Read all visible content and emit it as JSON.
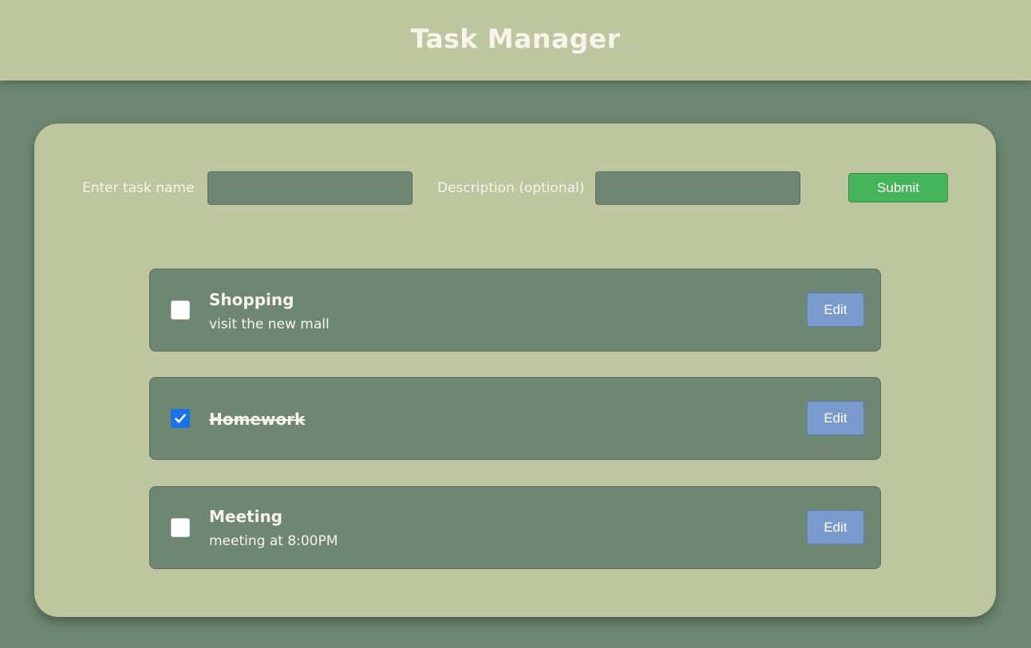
{
  "header": {
    "title": "Task Manager"
  },
  "form": {
    "task_name_label": "Enter task name",
    "task_name_value": "",
    "description_label": "Description (optional)",
    "description_value": "",
    "submit_label": "Submit"
  },
  "tasks": [
    {
      "title": "Shopping",
      "description": "visit the new mall",
      "completed": false,
      "edit_label": "Edit"
    },
    {
      "title": "Homework",
      "description": "",
      "completed": true,
      "edit_label": "Edit"
    },
    {
      "title": "Meeting",
      "description": "meeting at 8:00PM",
      "completed": false,
      "edit_label": "Edit"
    }
  ],
  "colors": {
    "page_background": "#6e8772",
    "panel_background": "#bec69f",
    "submit_button": "#45b35a",
    "edit_button": "#7a99cc",
    "checkbox_checked": "#1a73e8",
    "text": "#f7f4ea"
  },
  "icons": {
    "checked_mark": "checkmark-icon"
  }
}
